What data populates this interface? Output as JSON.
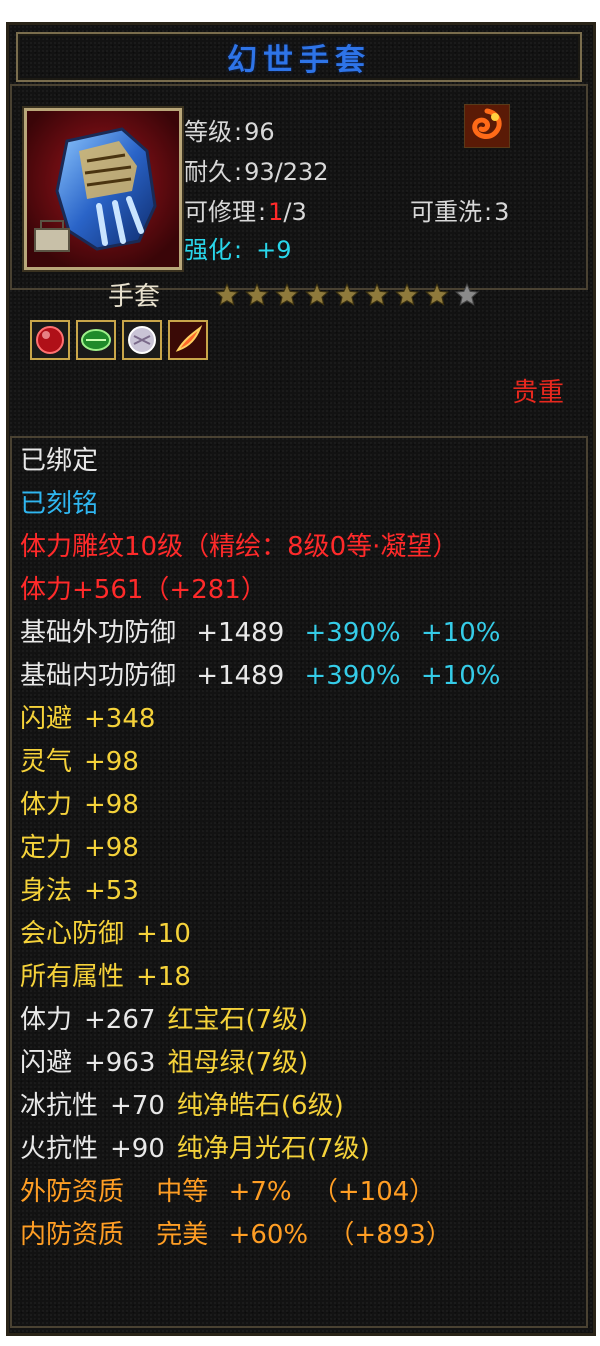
{
  "item": {
    "name": "幻世手套",
    "level_label": "等级",
    "level_value": "96",
    "durability_label": "耐久",
    "durability_value": "93/232",
    "repair_label": "可修理",
    "repair_current": "1",
    "repair_total": "/3",
    "reroll_label": "可重洗",
    "reroll_value": "3",
    "enhance_label": "强化",
    "enhance_value": "+9",
    "type": "手套",
    "stars_total": 9,
    "stars_filled": 8,
    "rarity": "贵重"
  },
  "gems": [
    "ruby-gem-icon",
    "emerald-gem-icon",
    "diamond-gem-icon",
    "moonstone-gem-icon"
  ],
  "stats": {
    "bound": "已绑定",
    "engraved": "已刻铭",
    "carving": "体力雕纹10级（精绘：8级0等·凝望）",
    "vit_bonus": "体力+561（+281）",
    "ext_def": {
      "label": "基础外功防御",
      "value": "+1489",
      "pct1": "+390%",
      "pct2": "+10%"
    },
    "int_def": {
      "label": "基础内功防御",
      "value": "+1489",
      "pct1": "+390%",
      "pct2": "+10%"
    },
    "attrs": [
      {
        "name": "闪避",
        "value": "+348"
      },
      {
        "name": "灵气",
        "value": "+98"
      },
      {
        "name": "体力",
        "value": "+98"
      },
      {
        "name": "定力",
        "value": "+98"
      },
      {
        "name": "身法",
        "value": "+53"
      },
      {
        "name": "会心防御",
        "value": "+10"
      },
      {
        "name": "所有属性",
        "value": "+18"
      }
    ],
    "gem_stats": [
      {
        "name": "体力",
        "value": "+267",
        "gem": "红宝石(7级)"
      },
      {
        "name": "闪避",
        "value": "+963",
        "gem": "祖母绿(7级)"
      },
      {
        "name": "冰抗性",
        "value": "+70",
        "gem": "纯净皓石(6级)"
      },
      {
        "name": "火抗性",
        "value": "+90",
        "gem": "纯净月光石(7级)"
      }
    ],
    "qualities": [
      {
        "name": "外防资质",
        "grade": "中等",
        "pct": "+7%",
        "bonus": "（+104）"
      },
      {
        "name": "内防资质",
        "grade": "完美",
        "pct": "+60%",
        "bonus": "（+893）"
      }
    ]
  },
  "colors": {
    "title": "#2e74e8",
    "rarity": "#e8281e",
    "bound": "#e8e8e8",
    "engraved": "#2fb6f0",
    "carving": "#ff2a2a",
    "attr": "#f5d23a",
    "quality": "#ff9e24"
  }
}
